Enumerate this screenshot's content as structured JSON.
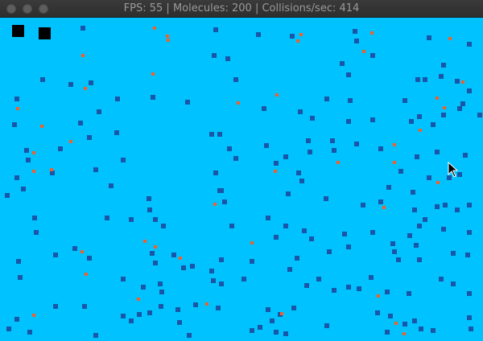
{
  "window": {
    "title": "FPS: 55 | Molecules: 200 | Collisions/sec: 414"
  },
  "colors": {
    "background": "#00c2ff",
    "molecule": "#1a56a8",
    "hot_molecule": "#f0602a",
    "large_particle": "#000000"
  },
  "stats": {
    "fps": 55,
    "molecules": 200,
    "collisions_per_sec": 414
  },
  "icons": [
    "close-icon",
    "minimize-icon",
    "maximize-icon",
    "mouse-cursor-icon"
  ]
}
